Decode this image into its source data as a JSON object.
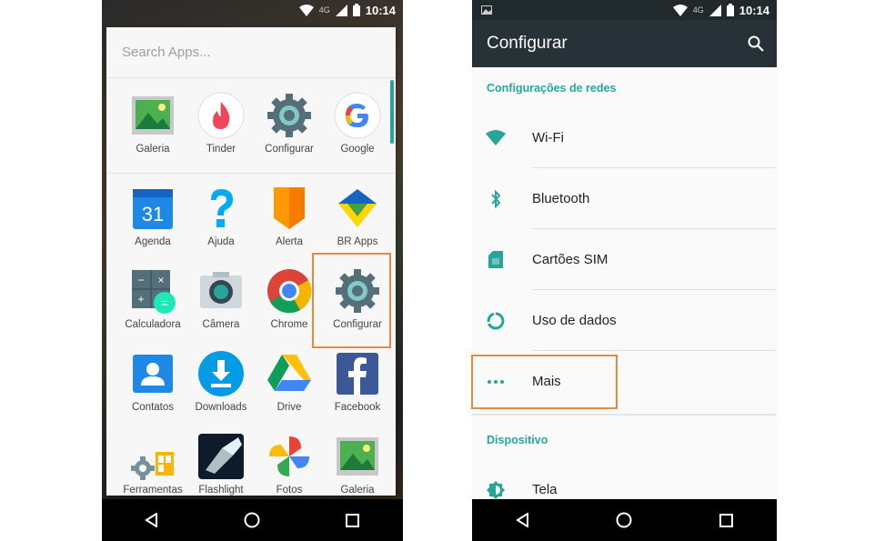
{
  "status": {
    "time": "10:14",
    "network": "4G"
  },
  "left": {
    "search_placeholder": "Search Apps...",
    "apps": [
      {
        "label": "Galeria"
      },
      {
        "label": "Tinder"
      },
      {
        "label": "Configurar"
      },
      {
        "label": "Google"
      },
      {
        "label": "Agenda"
      },
      {
        "label": "Ajuda"
      },
      {
        "label": "Alerta"
      },
      {
        "label": "BR Apps"
      },
      {
        "label": "Calculadora"
      },
      {
        "label": "Câmera"
      },
      {
        "label": "Chrome"
      },
      {
        "label": "Configurar"
      },
      {
        "label": "Contatos"
      },
      {
        "label": "Downloads"
      },
      {
        "label": "Drive"
      },
      {
        "label": "Facebook"
      },
      {
        "label": "Ferramentas"
      },
      {
        "label": "Flashlight"
      },
      {
        "label": "Fotos"
      },
      {
        "label": "Galeria"
      }
    ],
    "calendar_day": "31"
  },
  "right": {
    "title": "Configurar",
    "section_networks": "Configurações de redes",
    "items": [
      {
        "label": "Wi-Fi"
      },
      {
        "label": "Bluetooth"
      },
      {
        "label": "Cartões SIM"
      },
      {
        "label": "Uso de dados"
      },
      {
        "label": "Mais"
      }
    ],
    "section_device": "Dispositivo",
    "device_items": [
      {
        "label": "Tela"
      }
    ]
  },
  "colors": {
    "accent": "#26a69a",
    "appbar": "#263238",
    "highlight": "#e8893d"
  }
}
